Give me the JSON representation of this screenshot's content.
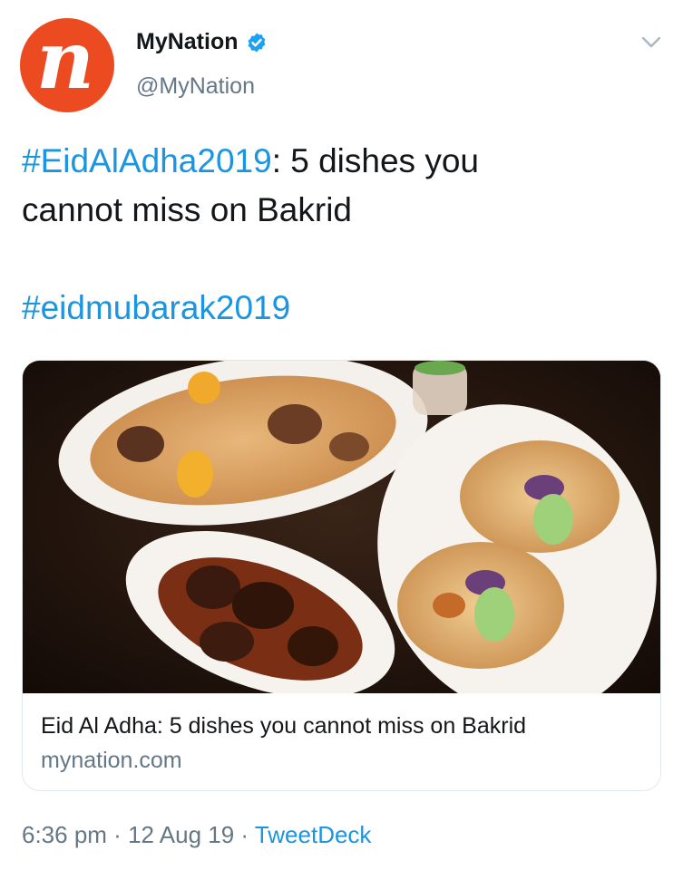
{
  "tweet": {
    "avatar": {
      "letter": "n",
      "color": "#ec4a20"
    },
    "display_name": "MyNation",
    "verified_icon": "verified-badge-icon",
    "handle": "@MyNation",
    "menu_icon": "chevron-down-icon",
    "text": {
      "hashtag1": "#EidAlAdha2019",
      "line1_rest": ": 5 dishes you",
      "line2": "cannot miss on Bakrid",
      "hashtag2": "#eidmubarak2019"
    },
    "card": {
      "image_alt": "food-photo",
      "title": "Eid Al Adha: 5 dishes you cannot miss on Bakrid",
      "domain": "mynation.com"
    },
    "meta": {
      "time": "6:36 pm",
      "sep1": " · ",
      "date": "12 Aug 19",
      "sep2": " · ",
      "source": "TweetDeck"
    }
  },
  "colors": {
    "link": "#1b95e0",
    "secondary_text": "#657786",
    "primary_text": "#14171a",
    "border": "#e1e8ed"
  }
}
